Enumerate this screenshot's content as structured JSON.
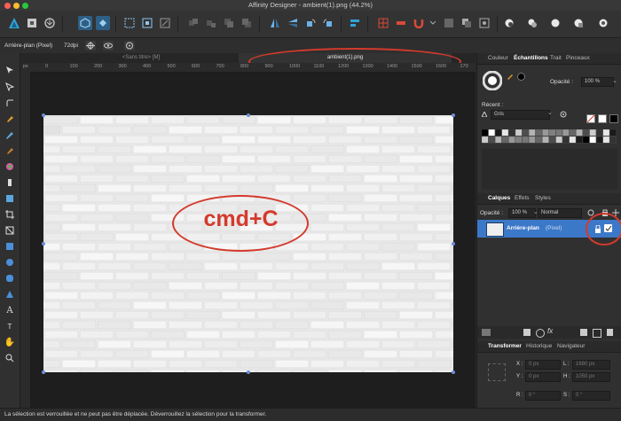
{
  "window": {
    "title": "Affinity Designer - ambient(1).png (44.2%)"
  },
  "context_bar": {
    "layer_name": "Arrière-plan (Pixel)",
    "dpi": "72dpi"
  },
  "tabs": [
    {
      "label": "<Sans titre> [M]"
    },
    {
      "label": "ambient(1).png"
    }
  ],
  "ruler": {
    "unit": "px",
    "ticks": [
      "0",
      "100",
      "200",
      "300",
      "400",
      "500",
      "600",
      "700",
      "800",
      "900",
      "1000",
      "1100",
      "1200",
      "1300",
      "1400",
      "1500",
      "1600",
      "170"
    ]
  },
  "canvas": {
    "annotation": "cmd+C"
  },
  "right_panel": {
    "top_tabs": [
      "Couleur",
      "Échantillons",
      "Trait",
      "Pinceaux"
    ],
    "opacity_label": "Opacité :",
    "opacity_value": "100 %",
    "recent_label": "Récent :",
    "palette_name": "Gris",
    "layer_tabs": [
      "Calques",
      "Effets",
      "Styles"
    ],
    "layer_opacity_label": "Opacité :",
    "layer_opacity_value": "100 %",
    "blend_mode": "Normal",
    "layer_name": "Arrière-plan",
    "layer_type": "(Pixel)",
    "transform_tabs": [
      "Transformer",
      "Historique",
      "Navigateur"
    ],
    "transform": {
      "x": "0 px",
      "y": "0 px",
      "w": "1680 px",
      "h": "1050 px",
      "r": "0 °",
      "s": "0 °",
      "x_label": "X :",
      "y_label": "Y :",
      "w_label": "L :",
      "h_label": "H :",
      "r_label": "R :",
      "s_label": "S :"
    }
  },
  "status": {
    "text": "La sélection est verrouillée et ne peut pas être déplacée. Déverrouillez la sélection pour la transformer."
  },
  "colors": {
    "annotation_red": "#d43a2c",
    "selection_blue": "#3d6fcf",
    "accent_cyan": "#2fa5d6"
  }
}
